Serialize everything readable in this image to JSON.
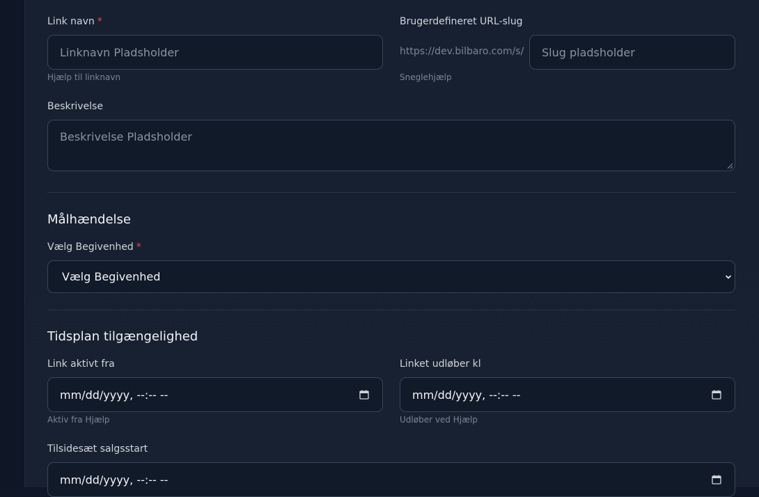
{
  "details": {
    "link_name_label": "Link navn",
    "link_name_required": "*",
    "link_name_placeholder": "Linknavn Pladsholder",
    "link_name_help": "Hjælp til linknavn",
    "slug_label": "Brugerdefineret URL-slug",
    "slug_prefix": "https://dev.bilbaro.com/s/",
    "slug_placeholder": "Slug pladsholder",
    "slug_help": "Sneglehjælp",
    "description_label": "Beskrivelse",
    "description_placeholder": "Beskrivelse Pladsholder"
  },
  "goal_event": {
    "title": "Målhændelse",
    "select_label": "Vælg Begivenhed",
    "select_required": "*",
    "selected_value": "Vælg Begivenhed"
  },
  "schedule": {
    "title": "Tidsplan tilgængelighed",
    "active_from_label": "Link aktivt fra",
    "active_from_value": "mm/dd/yyyy, --:-- --",
    "active_from_help": "Aktiv fra Hjælp",
    "expires_label": "Linket udløber kl",
    "expires_value": "mm/dd/yyyy, --:-- --",
    "expires_help": "Udløber ved Hjælp",
    "override_label": "Tilsidesæt salgsstart",
    "override_value": "mm/dd/yyyy, --:-- --"
  },
  "icons": {
    "calendar": "calendar-icon",
    "chevron": "chevron-down-icon"
  },
  "colors": {
    "background": "#101827",
    "panel": "#172131",
    "input_bg": "#111a29",
    "input_border": "#3a4556",
    "required": "#ef4444"
  }
}
